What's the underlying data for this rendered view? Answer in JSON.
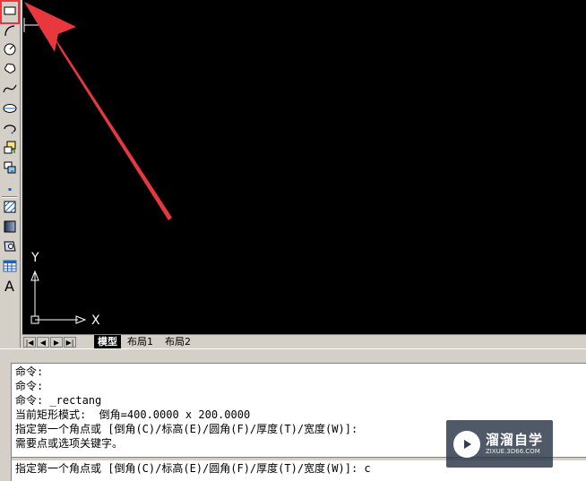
{
  "toolbar": {
    "tools": [
      {
        "name": "rectangle-tool"
      },
      {
        "name": "arc-tool"
      },
      {
        "name": "circle-tool"
      },
      {
        "name": "revision-cloud-tool"
      },
      {
        "name": "spline-tool"
      },
      {
        "name": "ellipse-tool"
      },
      {
        "name": "ellipse-arc-tool"
      },
      {
        "name": "insert-block-tool"
      },
      {
        "name": "make-block-tool"
      },
      {
        "name": "point-tool"
      },
      {
        "name": "hatch-tool"
      },
      {
        "name": "gradient-tool"
      },
      {
        "name": "region-tool"
      },
      {
        "name": "table-tool"
      },
      {
        "name": "multiline-text-tool",
        "label": "A"
      }
    ]
  },
  "ucs": {
    "y_label": "Y",
    "x_label": "X"
  },
  "layout_tabs": [
    {
      "label": "模型",
      "active": true
    },
    {
      "label": "布局1",
      "active": false
    },
    {
      "label": "布局2",
      "active": false
    }
  ],
  "command_history": [
    "命令:",
    "命令:",
    "命令: _rectang",
    "当前矩形模式:  倒角=400.0000 x 200.0000",
    "指定第一个角点或 [倒角(C)/标高(E)/圆角(F)/厚度(T)/宽度(W)]:",
    "需要点或选项关键字。"
  ],
  "command_prompt": "指定第一个角点或 [倒角(C)/标高(E)/圆角(F)/厚度(T)/宽度(W)]: c",
  "watermark": {
    "title": "溜溜自学",
    "subtitle": "ZIXUE.3D66.COM"
  },
  "colors": {
    "canvas": "#000000",
    "highlight": "#e8383d",
    "chrome": "#d4d0c8"
  }
}
